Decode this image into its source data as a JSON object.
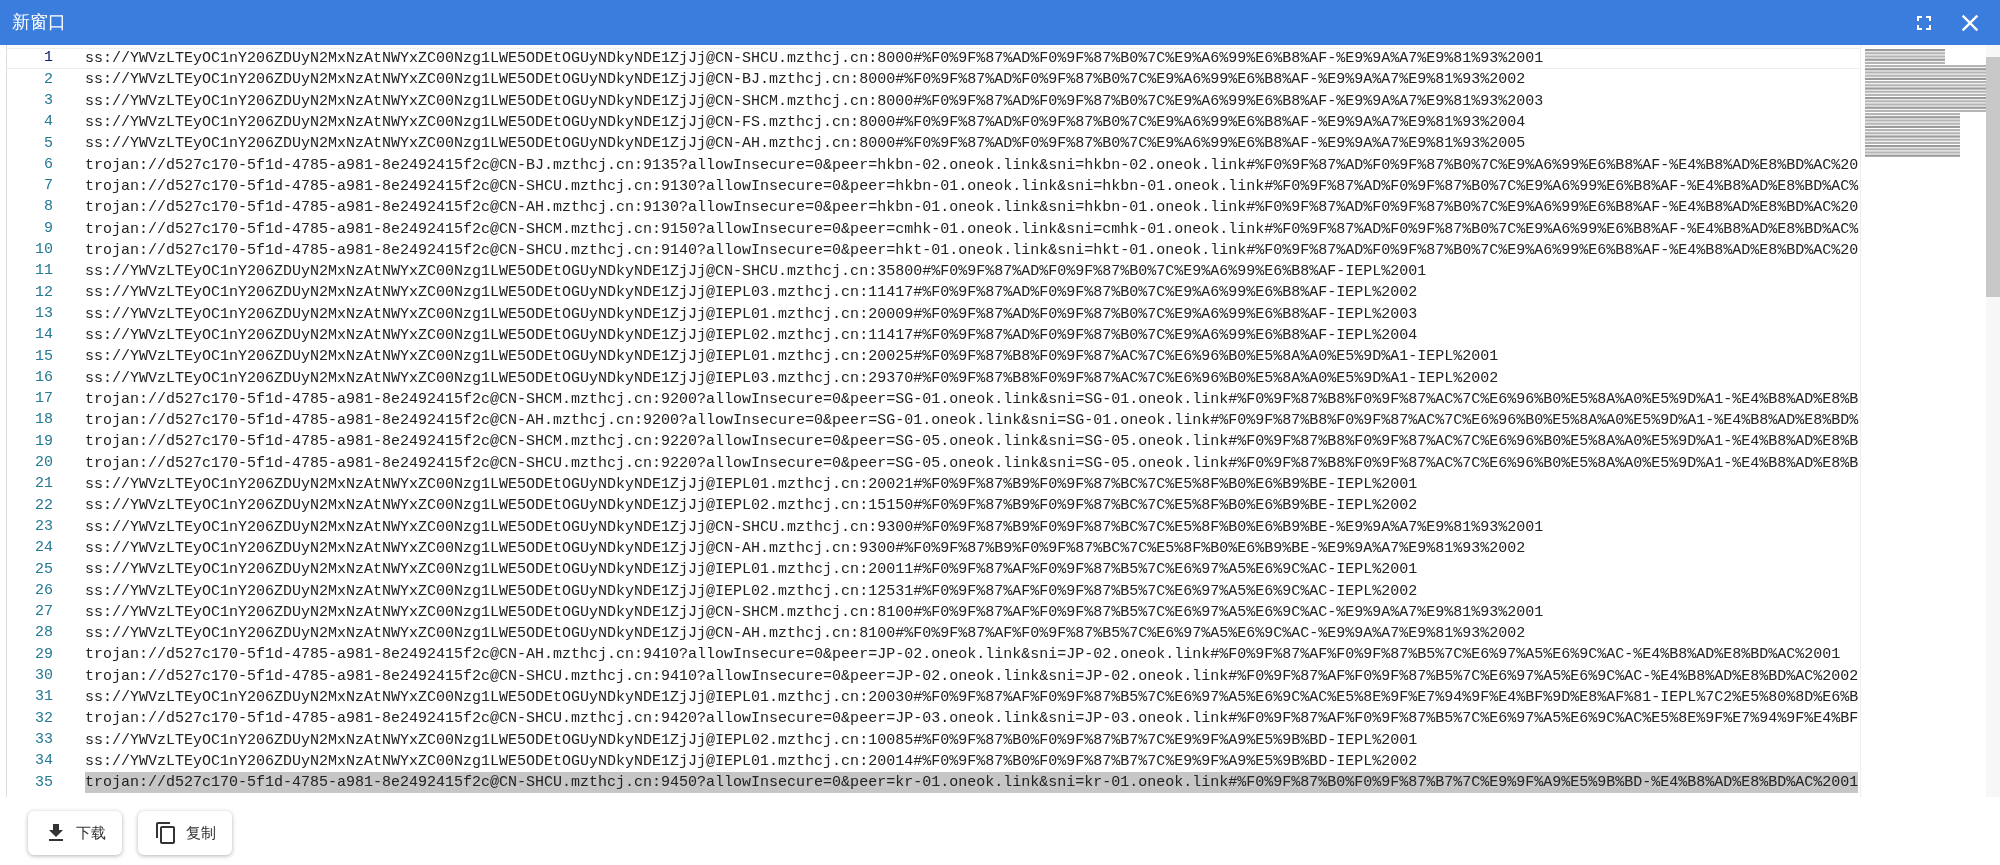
{
  "window": {
    "title": "新窗口"
  },
  "editor": {
    "lines": [
      {
        "number": "1",
        "active": true,
        "selected": false,
        "text": "ss://YWVzLTEyOC1nY206ZDUyN2MxNzAtNWYxZC00Nzg1LWE5ODEtOGUyNDkyNDE1ZjJj@CN-SHCU.mzthcj.cn:8000#%F0%9F%87%AD%F0%9F%87%B0%7C%E9%A6%99%E6%B8%AF-%E9%9A%A7%E9%81%93%2001"
      },
      {
        "number": "2",
        "active": false,
        "selected": false,
        "text": "ss://YWVzLTEyOC1nY206ZDUyN2MxNzAtNWYxZC00Nzg1LWE5ODEtOGUyNDkyNDE1ZjJj@CN-BJ.mzthcj.cn:8000#%F0%9F%87%AD%F0%9F%87%B0%7C%E9%A6%99%E6%B8%AF-%E9%9A%A7%E9%81%93%2002"
      },
      {
        "number": "3",
        "active": false,
        "selected": false,
        "text": "ss://YWVzLTEyOC1nY206ZDUyN2MxNzAtNWYxZC00Nzg1LWE5ODEtOGUyNDkyNDE1ZjJj@CN-SHCM.mzthcj.cn:8000#%F0%9F%87%AD%F0%9F%87%B0%7C%E9%A6%99%E6%B8%AF-%E9%9A%A7%E9%81%93%2003"
      },
      {
        "number": "4",
        "active": false,
        "selected": false,
        "text": "ss://YWVzLTEyOC1nY206ZDUyN2MxNzAtNWYxZC00Nzg1LWE5ODEtOGUyNDkyNDE1ZjJj@CN-FS.mzthcj.cn:8000#%F0%9F%87%AD%F0%9F%87%B0%7C%E9%A6%99%E6%B8%AF-%E9%9A%A7%E9%81%93%2004"
      },
      {
        "number": "5",
        "active": false,
        "selected": false,
        "text": "ss://YWVzLTEyOC1nY206ZDUyN2MxNzAtNWYxZC00Nzg1LWE5ODEtOGUyNDkyNDE1ZjJj@CN-AH.mzthcj.cn:8000#%F0%9F%87%AD%F0%9F%87%B0%7C%E9%A6%99%E6%B8%AF-%E9%9A%A7%E9%81%93%2005"
      },
      {
        "number": "6",
        "active": false,
        "selected": false,
        "text": "trojan://d527c170-5f1d-4785-a981-8e2492415f2c@CN-BJ.mzthcj.cn:9135?allowInsecure=0&peer=hkbn-02.oneok.link&sni=hkbn-02.oneok.link#%F0%9F%87%AD%F0%9F%87%B0%7C%E9%A6%99%E6%B8%AF-%E4%B8%AD%E8%BD%AC%20"
      },
      {
        "number": "7",
        "active": false,
        "selected": false,
        "text": "trojan://d527c170-5f1d-4785-a981-8e2492415f2c@CN-SHCU.mzthcj.cn:9130?allowInsecure=0&peer=hkbn-01.oneok.link&sni=hkbn-01.oneok.link#%F0%9F%87%AD%F0%9F%87%B0%7C%E9%A6%99%E6%B8%AF-%E4%B8%AD%E8%BD%AC%"
      },
      {
        "number": "8",
        "active": false,
        "selected": false,
        "text": "trojan://d527c170-5f1d-4785-a981-8e2492415f2c@CN-AH.mzthcj.cn:9130?allowInsecure=0&peer=hkbn-01.oneok.link&sni=hkbn-01.oneok.link#%F0%9F%87%AD%F0%9F%87%B0%7C%E9%A6%99%E6%B8%AF-%E4%B8%AD%E8%BD%AC%20"
      },
      {
        "number": "9",
        "active": false,
        "selected": false,
        "text": "trojan://d527c170-5f1d-4785-a981-8e2492415f2c@CN-SHCM.mzthcj.cn:9150?allowInsecure=0&peer=cmhk-01.oneok.link&sni=cmhk-01.oneok.link#%F0%9F%87%AD%F0%9F%87%B0%7C%E9%A6%99%E6%B8%AF-%E4%B8%AD%E8%BD%AC%"
      },
      {
        "number": "10",
        "active": false,
        "selected": false,
        "text": "trojan://d527c170-5f1d-4785-a981-8e2492415f2c@CN-SHCU.mzthcj.cn:9140?allowInsecure=0&peer=hkt-01.oneok.link&sni=hkt-01.oneok.link#%F0%9F%87%AD%F0%9F%87%B0%7C%E9%A6%99%E6%B8%AF-%E4%B8%AD%E8%BD%AC%20"
      },
      {
        "number": "11",
        "active": false,
        "selected": false,
        "text": "ss://YWVzLTEyOC1nY206ZDUyN2MxNzAtNWYxZC00Nzg1LWE5ODEtOGUyNDkyNDE1ZjJj@CN-SHCU.mzthcj.cn:35800#%F0%9F%87%AD%F0%9F%87%B0%7C%E9%A6%99%E6%B8%AF-IEPL%2001"
      },
      {
        "number": "12",
        "active": false,
        "selected": false,
        "text": "ss://YWVzLTEyOC1nY206ZDUyN2MxNzAtNWYxZC00Nzg1LWE5ODEtOGUyNDkyNDE1ZjJj@IEPL03.mzthcj.cn:11417#%F0%9F%87%AD%F0%9F%87%B0%7C%E9%A6%99%E6%B8%AF-IEPL%2002"
      },
      {
        "number": "13",
        "active": false,
        "selected": false,
        "text": "ss://YWVzLTEyOC1nY206ZDUyN2MxNzAtNWYxZC00Nzg1LWE5ODEtOGUyNDkyNDE1ZjJj@IEPL01.mzthcj.cn:20009#%F0%9F%87%AD%F0%9F%87%B0%7C%E9%A6%99%E6%B8%AF-IEPL%2003"
      },
      {
        "number": "14",
        "active": false,
        "selected": false,
        "text": "ss://YWVzLTEyOC1nY206ZDUyN2MxNzAtNWYxZC00Nzg1LWE5ODEtOGUyNDkyNDE1ZjJj@IEPL02.mzthcj.cn:11417#%F0%9F%87%AD%F0%9F%87%B0%7C%E9%A6%99%E6%B8%AF-IEPL%2004"
      },
      {
        "number": "15",
        "active": false,
        "selected": false,
        "text": "ss://YWVzLTEyOC1nY206ZDUyN2MxNzAtNWYxZC00Nzg1LWE5ODEtOGUyNDkyNDE1ZjJj@IEPL01.mzthcj.cn:20025#%F0%9F%87%B8%F0%9F%87%AC%7C%E6%96%B0%E5%8A%A0%E5%9D%A1-IEPL%2001"
      },
      {
        "number": "16",
        "active": false,
        "selected": false,
        "text": "ss://YWVzLTEyOC1nY206ZDUyN2MxNzAtNWYxZC00Nzg1LWE5ODEtOGUyNDkyNDE1ZjJj@IEPL03.mzthcj.cn:29370#%F0%9F%87%B8%F0%9F%87%AC%7C%E6%96%B0%E5%8A%A0%E5%9D%A1-IEPL%2002"
      },
      {
        "number": "17",
        "active": false,
        "selected": false,
        "text": "trojan://d527c170-5f1d-4785-a981-8e2492415f2c@CN-SHCM.mzthcj.cn:9200?allowInsecure=0&peer=SG-01.oneok.link&sni=SG-01.oneok.link#%F0%9F%87%B8%F0%9F%87%AC%7C%E6%96%B0%E5%8A%A0%E5%9D%A1-%E4%B8%AD%E8%B"
      },
      {
        "number": "18",
        "active": false,
        "selected": false,
        "text": "trojan://d527c170-5f1d-4785-a981-8e2492415f2c@CN-AH.mzthcj.cn:9200?allowInsecure=0&peer=SG-01.oneok.link&sni=SG-01.oneok.link#%F0%9F%87%B8%F0%9F%87%AC%7C%E6%96%B0%E5%8A%A0%E5%9D%A1-%E4%B8%AD%E8%BD%"
      },
      {
        "number": "19",
        "active": false,
        "selected": false,
        "text": "trojan://d527c170-5f1d-4785-a981-8e2492415f2c@CN-SHCM.mzthcj.cn:9220?allowInsecure=0&peer=SG-05.oneok.link&sni=SG-05.oneok.link#%F0%9F%87%B8%F0%9F%87%AC%7C%E6%96%B0%E5%8A%A0%E5%9D%A1-%E4%B8%AD%E8%B"
      },
      {
        "number": "20",
        "active": false,
        "selected": false,
        "text": "trojan://d527c170-5f1d-4785-a981-8e2492415f2c@CN-SHCU.mzthcj.cn:9220?allowInsecure=0&peer=SG-05.oneok.link&sni=SG-05.oneok.link#%F0%9F%87%B8%F0%9F%87%AC%7C%E6%96%B0%E5%8A%A0%E5%9D%A1-%E4%B8%AD%E8%B"
      },
      {
        "number": "21",
        "active": false,
        "selected": false,
        "text": "ss://YWVzLTEyOC1nY206ZDUyN2MxNzAtNWYxZC00Nzg1LWE5ODEtOGUyNDkyNDE1ZjJj@IEPL01.mzthcj.cn:20021#%F0%9F%87%B9%F0%9F%87%BC%7C%E5%8F%B0%E6%B9%BE-IEPL%2001"
      },
      {
        "number": "22",
        "active": false,
        "selected": false,
        "text": "ss://YWVzLTEyOC1nY206ZDUyN2MxNzAtNWYxZC00Nzg1LWE5ODEtOGUyNDkyNDE1ZjJj@IEPL02.mzthcj.cn:15150#%F0%9F%87%B9%F0%9F%87%BC%7C%E5%8F%B0%E6%B9%BE-IEPL%2002"
      },
      {
        "number": "23",
        "active": false,
        "selected": false,
        "text": "ss://YWVzLTEyOC1nY206ZDUyN2MxNzAtNWYxZC00Nzg1LWE5ODEtOGUyNDkyNDE1ZjJj@CN-SHCU.mzthcj.cn:9300#%F0%9F%87%B9%F0%9F%87%BC%7C%E5%8F%B0%E6%B9%BE-%E9%9A%A7%E9%81%93%2001"
      },
      {
        "number": "24",
        "active": false,
        "selected": false,
        "text": "ss://YWVzLTEyOC1nY206ZDUyN2MxNzAtNWYxZC00Nzg1LWE5ODEtOGUyNDkyNDE1ZjJj@CN-AH.mzthcj.cn:9300#%F0%9F%87%B9%F0%9F%87%BC%7C%E5%8F%B0%E6%B9%BE-%E9%9A%A7%E9%81%93%2002"
      },
      {
        "number": "25",
        "active": false,
        "selected": false,
        "text": "ss://YWVzLTEyOC1nY206ZDUyN2MxNzAtNWYxZC00Nzg1LWE5ODEtOGUyNDkyNDE1ZjJj@IEPL01.mzthcj.cn:20011#%F0%9F%87%AF%F0%9F%87%B5%7C%E6%97%A5%E6%9C%AC-IEPL%2001"
      },
      {
        "number": "26",
        "active": false,
        "selected": false,
        "text": "ss://YWVzLTEyOC1nY206ZDUyN2MxNzAtNWYxZC00Nzg1LWE5ODEtOGUyNDkyNDE1ZjJj@IEPL02.mzthcj.cn:12531#%F0%9F%87%AF%F0%9F%87%B5%7C%E6%97%A5%E6%9C%AC-IEPL%2002"
      },
      {
        "number": "27",
        "active": false,
        "selected": false,
        "text": "ss://YWVzLTEyOC1nY206ZDUyN2MxNzAtNWYxZC00Nzg1LWE5ODEtOGUyNDkyNDE1ZjJj@CN-SHCM.mzthcj.cn:8100#%F0%9F%87%AF%F0%9F%87%B5%7C%E6%97%A5%E6%9C%AC-%E9%9A%A7%E9%81%93%2001"
      },
      {
        "number": "28",
        "active": false,
        "selected": false,
        "text": "ss://YWVzLTEyOC1nY206ZDUyN2MxNzAtNWYxZC00Nzg1LWE5ODEtOGUyNDkyNDE1ZjJj@CN-AH.mzthcj.cn:8100#%F0%9F%87%AF%F0%9F%87%B5%7C%E6%97%A5%E6%9C%AC-%E9%9A%A7%E9%81%93%2002"
      },
      {
        "number": "29",
        "active": false,
        "selected": false,
        "text": "trojan://d527c170-5f1d-4785-a981-8e2492415f2c@CN-AH.mzthcj.cn:9410?allowInsecure=0&peer=JP-02.oneok.link&sni=JP-02.oneok.link#%F0%9F%87%AF%F0%9F%87%B5%7C%E6%97%A5%E6%9C%AC-%E4%B8%AD%E8%BD%AC%2001"
      },
      {
        "number": "30",
        "active": false,
        "selected": false,
        "text": "trojan://d527c170-5f1d-4785-a981-8e2492415f2c@CN-SHCU.mzthcj.cn:9410?allowInsecure=0&peer=JP-02.oneok.link&sni=JP-02.oneok.link#%F0%9F%87%AF%F0%9F%87%B5%7C%E6%97%A5%E6%9C%AC-%E4%B8%AD%E8%BD%AC%2002"
      },
      {
        "number": "31",
        "active": false,
        "selected": false,
        "text": "ss://YWVzLTEyOC1nY206ZDUyN2MxNzAtNWYxZC00Nzg1LWE5ODEtOGUyNDkyNDE1ZjJj@IEPL01.mzthcj.cn:20030#%F0%9F%87%AF%F0%9F%87%B5%7C%E6%97%A5%E6%9C%AC%E5%8E%9F%E7%94%9F%E4%BF%9D%E8%AF%81-IEPL%7C2%E5%80%8D%E6%B"
      },
      {
        "number": "32",
        "active": false,
        "selected": false,
        "text": "trojan://d527c170-5f1d-4785-a981-8e2492415f2c@CN-SHCU.mzthcj.cn:9420?allowInsecure=0&peer=JP-03.oneok.link&sni=JP-03.oneok.link#%F0%9F%87%AF%F0%9F%87%B5%7C%E6%97%A5%E6%9C%AC%E5%8E%9F%E7%94%9F%E4%BF"
      },
      {
        "number": "33",
        "active": false,
        "selected": false,
        "text": "ss://YWVzLTEyOC1nY206ZDUyN2MxNzAtNWYxZC00Nzg1LWE5ODEtOGUyNDkyNDE1ZjJj@IEPL02.mzthcj.cn:10085#%F0%9F%87%B0%F0%9F%87%B7%7C%E9%9F%A9%E5%9B%BD-IEPL%2001"
      },
      {
        "number": "34",
        "active": false,
        "selected": false,
        "text": "ss://YWVzLTEyOC1nY206ZDUyN2MxNzAtNWYxZC00Nzg1LWE5ODEtOGUyNDkyNDE1ZjJj@IEPL01.mzthcj.cn:20014#%F0%9F%87%B0%F0%9F%87%B7%7C%E9%9F%A9%E5%9B%BD-IEPL%2002"
      },
      {
        "number": "35",
        "active": false,
        "selected": true,
        "text": "trojan://d527c170-5f1d-4785-a981-8e2492415f2c@CN-SHCU.mzthcj.cn:9450?allowInsecure=0&peer=kr-01.oneok.link&sni=kr-01.oneok.link#%F0%9F%87%B0%F0%9F%87%B7%7C%E9%9F%A9%E5%9B%BD-%E4%B8%AD%E8%BD%AC%2001"
      }
    ]
  },
  "buttons": [
    {
      "kind": "download",
      "label": "下载"
    },
    {
      "kind": "copy",
      "label": "复制"
    }
  ]
}
